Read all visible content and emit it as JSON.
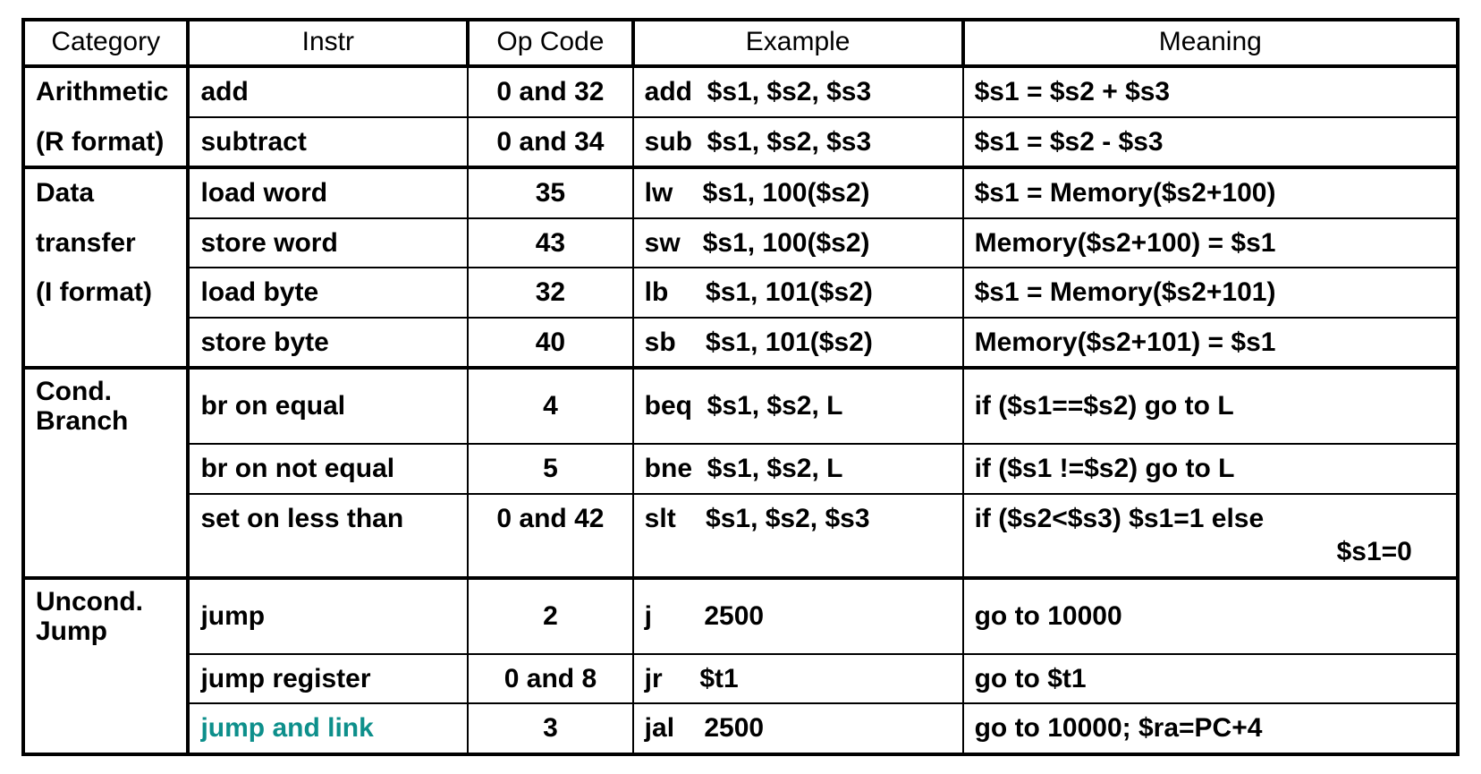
{
  "chart_data": {
    "type": "table",
    "title": "MIPS Instruction Reference",
    "columns": [
      "Category",
      "Instr",
      "Op Code",
      "Example",
      "Meaning"
    ],
    "rows": [
      {
        "category": "Arithmetic (R format)",
        "instr": "add",
        "opcode": "0 and 32",
        "example": "add  $s1, $s2, $s3",
        "meaning": "$s1 = $s2 + $s3"
      },
      {
        "category": "Arithmetic (R format)",
        "instr": "subtract",
        "opcode": "0 and 34",
        "example": "sub  $s1, $s2, $s3",
        "meaning": "$s1 = $s2 - $s3"
      },
      {
        "category": "Data transfer (I format)",
        "instr": "load word",
        "opcode": "35",
        "example": "lw    $s1, 100($s2)",
        "meaning": "$s1 = Memory($s2+100)"
      },
      {
        "category": "Data transfer (I format)",
        "instr": "store word",
        "opcode": "43",
        "example": "sw   $s1, 100($s2)",
        "meaning": "Memory($s2+100) = $s1"
      },
      {
        "category": "Data transfer (I format)",
        "instr": "load byte",
        "opcode": "32",
        "example": "lb     $s1, 101($s2)",
        "meaning": "$s1 = Memory($s2+101)"
      },
      {
        "category": "Data transfer (I format)",
        "instr": "store byte",
        "opcode": "40",
        "example": "sb    $s1, 101($s2)",
        "meaning": "Memory($s2+101) = $s1"
      },
      {
        "category": "Cond. Branch",
        "instr": "br on equal",
        "opcode": "4",
        "example": "beq  $s1, $s2, L",
        "meaning": "if ($s1==$s2) go to L"
      },
      {
        "category": "Cond. Branch",
        "instr": "br on not equal",
        "opcode": "5",
        "example": "bne  $s1, $s2, L",
        "meaning": "if ($s1 !=$s2) go to L"
      },
      {
        "category": "Cond. Branch",
        "instr": "set on less than",
        "opcode": "0 and 42",
        "example": "slt    $s1, $s2, $s3",
        "meaning": "if ($s2<$s3) $s1=1 else $s1=0"
      },
      {
        "category": "Uncond. Jump",
        "instr": "jump",
        "opcode": "2",
        "example": "j       2500",
        "meaning": "go to 10000"
      },
      {
        "category": "Uncond. Jump",
        "instr": "jump register",
        "opcode": "0 and 8",
        "example": "jr     $t1",
        "meaning": "go to $t1"
      },
      {
        "category": "Uncond. Jump",
        "instr": "jump and link",
        "opcode": "3",
        "example": "jal    2500",
        "meaning": "go to 10000; $ra=PC+4"
      }
    ]
  },
  "headers": {
    "c1": "Category",
    "c2": "Instr",
    "c3": "Op Code",
    "c4": "Example",
    "c5": "Meaning"
  },
  "cat": {
    "arith1": "Arithmetic",
    "arith2": "(R format)",
    "data1": "Data",
    "data2": "transfer",
    "data3": "(I format)",
    "cond1": "Cond.",
    "cond2": "Branch",
    "uncond1": "Uncond.",
    "uncond2": "Jump"
  },
  "rows": {
    "r0": {
      "instr": "add",
      "op": "0 and 32",
      "ex": "add  $s1, $s2, $s3",
      "mean": "$s1 = $s2 + $s3"
    },
    "r1": {
      "instr": "subtract",
      "op": "0 and 34",
      "ex": "sub  $s1, $s2, $s3",
      "mean": "$s1 = $s2 - $s3"
    },
    "r2": {
      "instr": "load word",
      "op": "35",
      "ex": "lw    $s1, 100($s2)",
      "mean": "$s1 = Memory($s2+100)"
    },
    "r3": {
      "instr": "store word",
      "op": "43",
      "ex": "sw   $s1, 100($s2)",
      "mean": "Memory($s2+100) = $s1"
    },
    "r4": {
      "instr": "load byte",
      "op": "32",
      "ex": "lb     $s1, 101($s2)",
      "mean": "$s1 = Memory($s2+101)"
    },
    "r5": {
      "instr": "store byte",
      "op": "40",
      "ex": "sb    $s1, 101($s2)",
      "mean": "Memory($s2+101) = $s1"
    },
    "r6": {
      "instr": "br on equal",
      "op": "4",
      "ex": "beq  $s1, $s2, L",
      "mean": "if ($s1==$s2) go to L"
    },
    "r7": {
      "instr": "br on not equal",
      "op": "5",
      "ex": "bne  $s1, $s2, L",
      "mean": "if ($s1 !=$s2) go to L"
    },
    "r8": {
      "instr": "set on less than",
      "op": "0 and 42",
      "ex": "slt    $s1, $s2, $s3",
      "mean1": "if ($s2<$s3) $s1=1 else",
      "mean2": "$s1=0"
    },
    "r9": {
      "instr": "jump",
      "op": "2",
      "ex": "j       2500",
      "mean": "go to 10000"
    },
    "r10": {
      "instr": "jump register",
      "op": "0 and 8",
      "ex": "jr     $t1",
      "mean": "go to $t1"
    },
    "r11": {
      "instr": "jump and link",
      "op": "3",
      "ex": "jal    2500",
      "mean": "go to 10000; $ra=PC+4"
    }
  },
  "colors": {
    "teal": "#0d8f8b"
  }
}
